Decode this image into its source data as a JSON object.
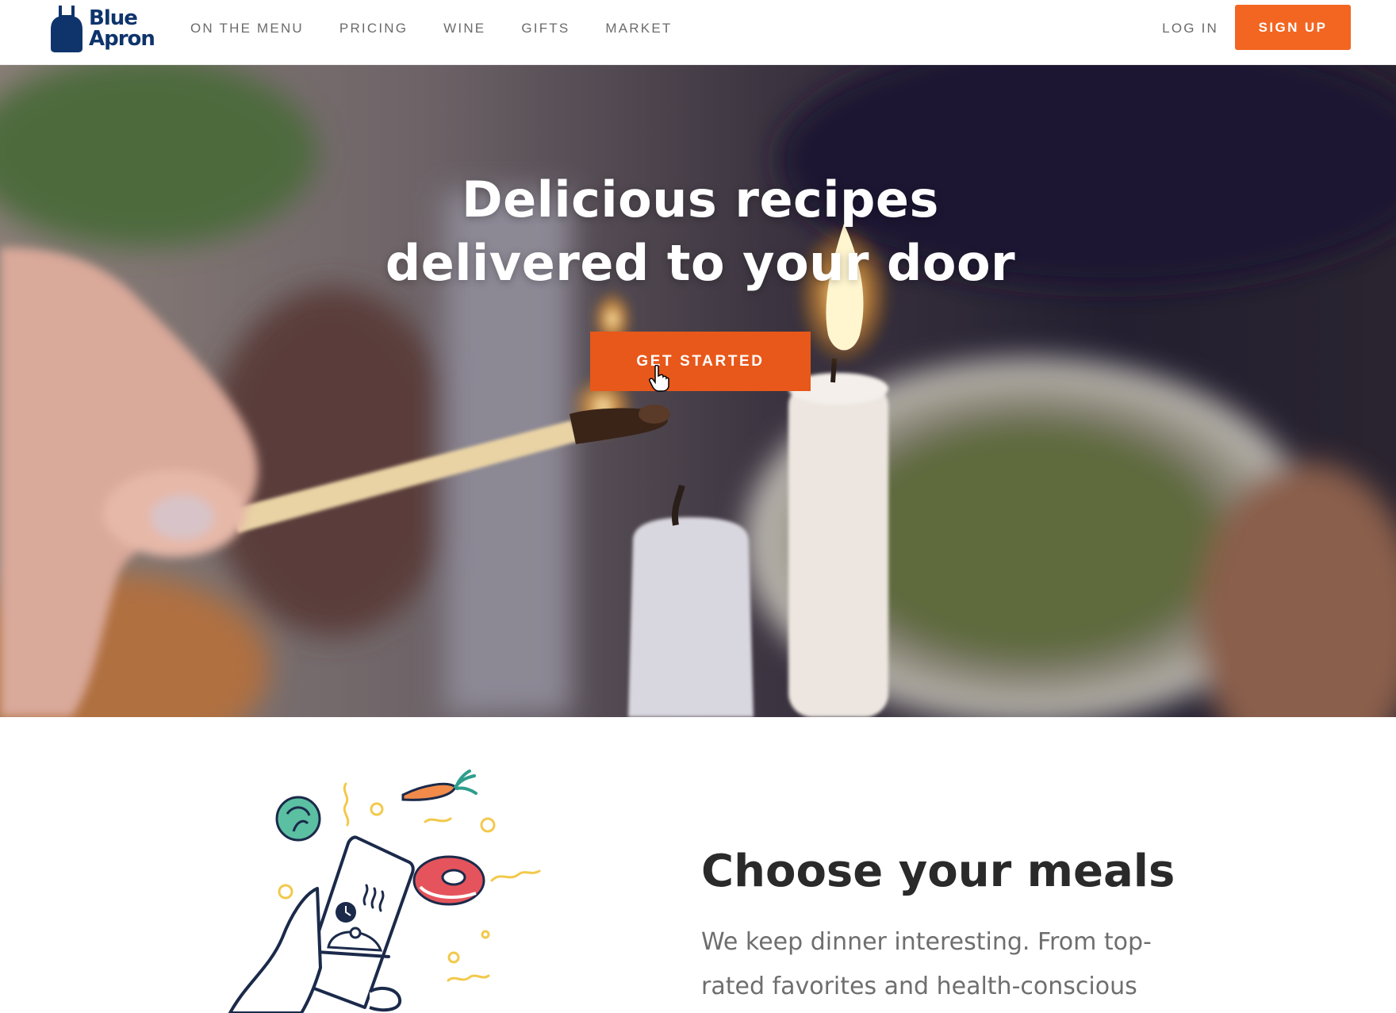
{
  "brand": {
    "name_line1": "Blue",
    "name_line2": "Apron",
    "color": "#0f346c",
    "accent": "#f26622"
  },
  "nav": {
    "items": [
      {
        "label": "ON THE MENU"
      },
      {
        "label": "PRICING"
      },
      {
        "label": "WINE"
      },
      {
        "label": "GIFTS"
      },
      {
        "label": "MARKET"
      }
    ],
    "login_label": "LOG IN",
    "signup_label": "SIGN UP"
  },
  "hero": {
    "title_line1": "Delicious recipes",
    "title_line2": "delivered to your door",
    "cta_label": "GET STARTED"
  },
  "feature": {
    "title": "Choose your meals",
    "body": "We keep dinner interesting. From top-rated favorites and health-conscious"
  },
  "icons": {
    "logo": "apron-icon",
    "cursor": "hand-pointer-icon",
    "illustration": "phone-meal-illustration"
  }
}
